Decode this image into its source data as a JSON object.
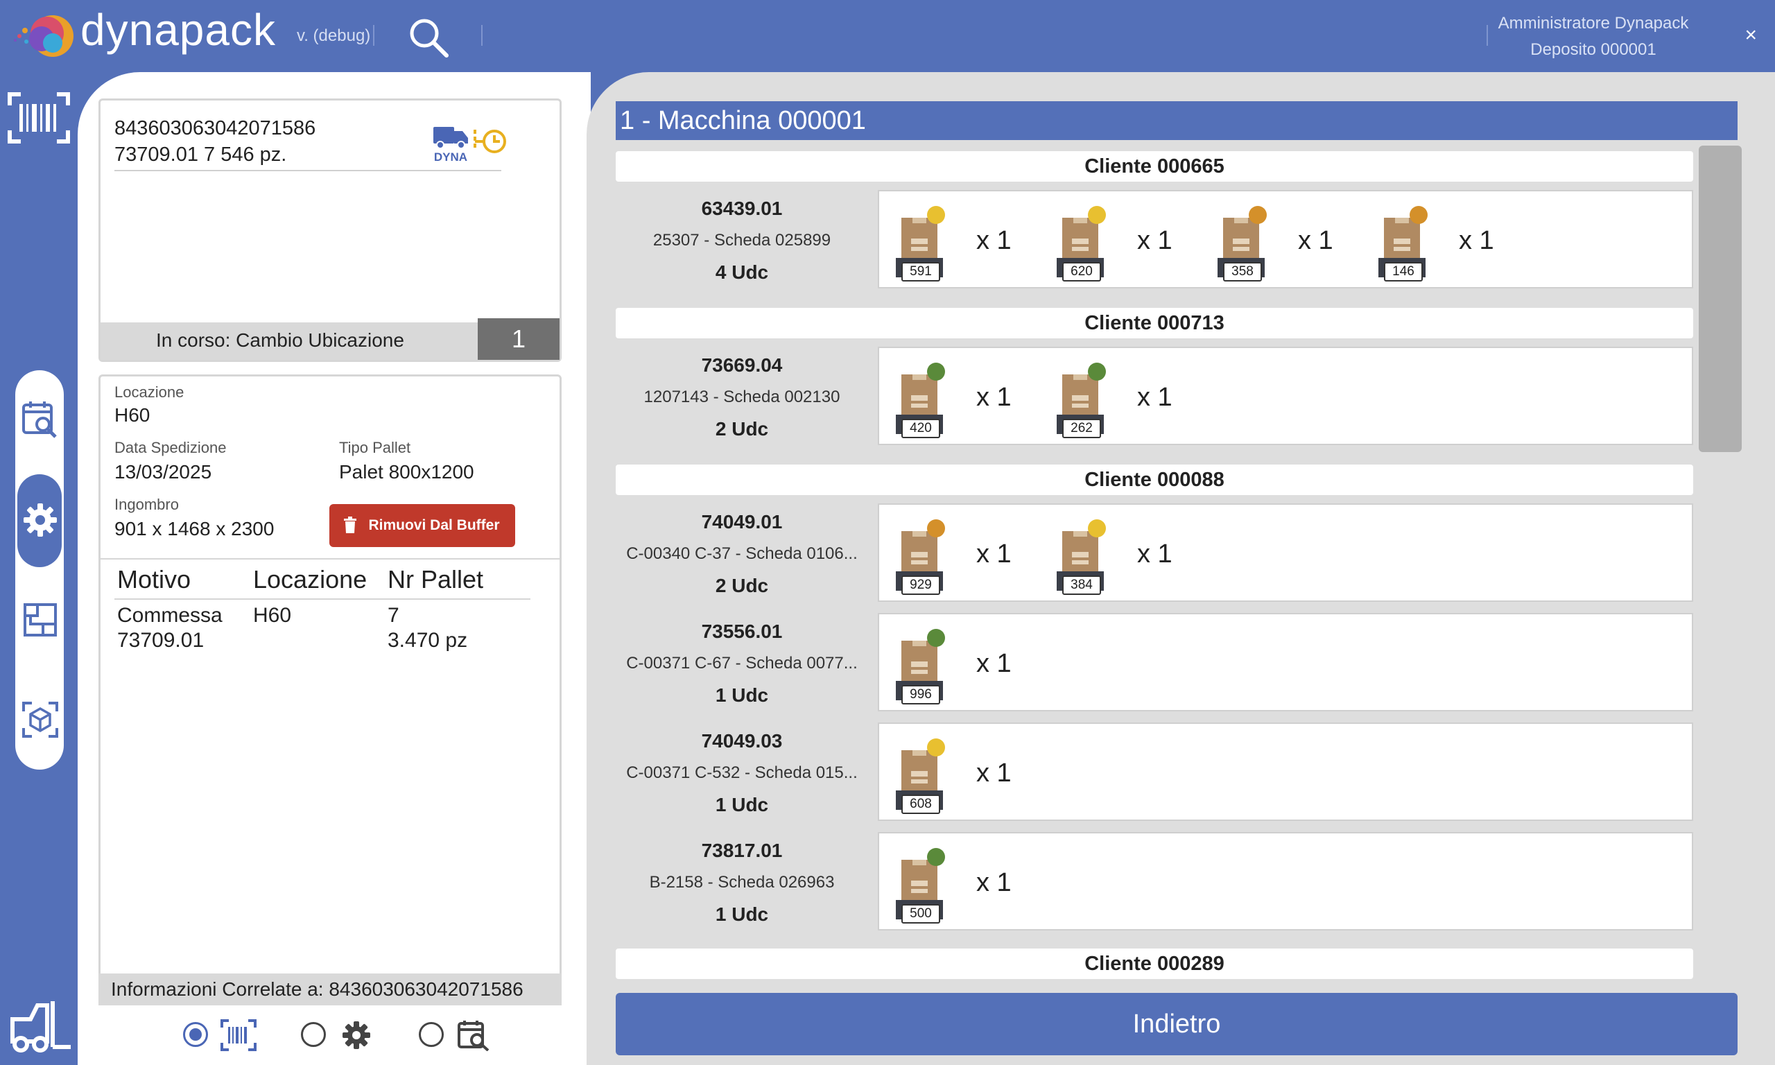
{
  "header": {
    "brand": "dynapack",
    "version": "v. (debug)",
    "user_name": "Amministratore Dynapack",
    "user_depot": "Deposito 000001",
    "close_label": "×"
  },
  "colors": {
    "primary": "#5470b8",
    "danger": "#c0392b",
    "badge_gray": "#707070"
  },
  "left": {
    "code": "843603063042071586",
    "article_line": "73709.01 7 546 pz.",
    "dyna_label": "DYNA",
    "status_text": "In corso:  Cambio Ubicazione",
    "status_count": "1",
    "info": {
      "location_label": "Locazione",
      "location_value": "H60",
      "ship_date_label": "Data Spedizione",
      "ship_date_value": "13/03/2025",
      "pallet_type_label": "Tipo Pallet",
      "pallet_type_value": "Palet 800x1200",
      "size_label": "Ingombro",
      "size_value": "901 x 1468 x 2300",
      "remove_button": "Rimuovi Dal Buffer"
    },
    "table": {
      "headers": [
        "Motivo",
        "Locazione",
        "Nr Pallet"
      ],
      "row": {
        "motivo_1": "Commessa",
        "motivo_2": "73709.01",
        "locazione": "H60",
        "pallet_1": "7",
        "pallet_2": "3.470 pz"
      }
    },
    "related": "Informazioni Correlate a:  843603063042071586"
  },
  "main": {
    "machine_title": "1 - Macchina 000001",
    "clients": [
      {
        "name": "Cliente 000665"
      },
      {
        "name": "Cliente 000713"
      },
      {
        "name": "Cliente 000088"
      },
      {
        "name": "Cliente 000289"
      }
    ],
    "orders": [
      {
        "code": "63439.01",
        "desc": "25307 - Scheda 025899",
        "udc": "4  Udc",
        "pallets": [
          {
            "num": "591",
            "dot": "#e8c030",
            "qty": "x 1"
          },
          {
            "num": "620",
            "dot": "#e8c030",
            "qty": "x 1"
          },
          {
            "num": "358",
            "dot": "#d4902a",
            "qty": "x 1"
          },
          {
            "num": "146",
            "dot": "#d4902a",
            "qty": "x 1"
          }
        ]
      },
      {
        "code": "73669.04",
        "desc": "1207143 - Scheda 002130",
        "udc": "2  Udc",
        "pallets": [
          {
            "num": "420",
            "dot": "#5a8a3a",
            "qty": "x 1"
          },
          {
            "num": "262",
            "dot": "#5a8a3a",
            "qty": "x 1"
          }
        ]
      },
      {
        "code": "74049.01",
        "desc": "C-00340 C-37 - Scheda 0106...",
        "udc": "2  Udc",
        "pallets": [
          {
            "num": "929",
            "dot": "#d4902a",
            "qty": "x 1"
          },
          {
            "num": "384",
            "dot": "#e8c030",
            "qty": "x 1"
          }
        ]
      },
      {
        "code": "73556.01",
        "desc": "C-00371 C-67 - Scheda 0077...",
        "udc": "1  Udc",
        "pallets": [
          {
            "num": "996",
            "dot": "#5a8a3a",
            "qty": "x 1"
          }
        ]
      },
      {
        "code": "74049.03",
        "desc": "C-00371 C-532 - Scheda 015...",
        "udc": "1  Udc",
        "pallets": [
          {
            "num": "608",
            "dot": "#e8c030",
            "qty": "x 1"
          }
        ]
      },
      {
        "code": "73817.01",
        "desc": "B-2158 - Scheda 026963",
        "udc": "1  Udc",
        "pallets": [
          {
            "num": "500",
            "dot": "#5a8a3a",
            "qty": "x 1"
          }
        ]
      }
    ],
    "back_button": "Indietro"
  },
  "icons": {
    "rail": [
      "barcode-icon",
      "calendar-search-icon",
      "gear-icon",
      "layout-icon",
      "box-scan-icon",
      "forklift-icon"
    ],
    "bottom_tabs": [
      "barcode-icon",
      "gear-icon",
      "calendar-search-icon"
    ]
  }
}
